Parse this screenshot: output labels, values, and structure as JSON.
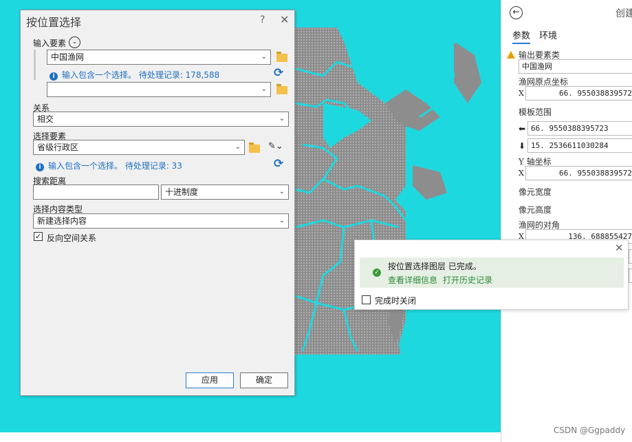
{
  "dialog": {
    "title": "按位置选择",
    "help": "?",
    "close": "✕",
    "input_features": {
      "label": "输入要素",
      "row1_value": "中国渔网",
      "row1_info": "输入包含一个选择。 待处理记录: 178,588",
      "row2_value": ""
    },
    "relationship": {
      "label": "关系",
      "value": "相交"
    },
    "selecting_features": {
      "label": "选择要素",
      "value": "省级行政区",
      "info": "输入包含一个选择。 待处理记录: 33"
    },
    "search_distance": {
      "label": "搜索距离",
      "value": "",
      "unit": "十进制度"
    },
    "selection_type": {
      "label": "选择内容类型",
      "value": "新建选择内容"
    },
    "invert": {
      "label": "反向空间关系",
      "checked": true
    },
    "apply_label": "应用",
    "ok_label": "确定"
  },
  "toast": {
    "message": "按位置选择图层 已完成。",
    "details_link": "查看详细信息",
    "history_link": "打开历史记录",
    "close_when_done": "完成时关闭"
  },
  "pane": {
    "title": "创建",
    "tabs": [
      "参数",
      "环境"
    ],
    "output_label": "输出要素类",
    "output_value": "中国渔网",
    "origin_label": "渔网原点坐标",
    "origin_x": "66. 955038839572",
    "template_label": "模板范围",
    "template_left": "66. 9550388395723",
    "template_bottom": "15. 2536611030284",
    "yaxis_label": "Y 轴坐标",
    "yaxis_x": "66. 955038839572",
    "cell_width_label": "像元宽度",
    "cell_height_label": "像元高度",
    "corner_label": "渔网的对角",
    "corner_x": "136. 688855427",
    "credit": "CSDN @Ggpaddy"
  },
  "icons": {
    "expand": "chevron-down-circle-icon",
    "folder": "folder-icon",
    "info": "info-icon",
    "refresh": "refresh-icon",
    "pencil": "pencil-icon",
    "success": "check-circle-icon",
    "warning": "warning-icon",
    "back": "back-arrow-icon"
  },
  "colors": {
    "sea": "#1ed8e0",
    "land": "#8d8d8d",
    "accent": "#1e6fc0",
    "success_band": "#e5efe3",
    "link_green": "#2d8a3a"
  }
}
